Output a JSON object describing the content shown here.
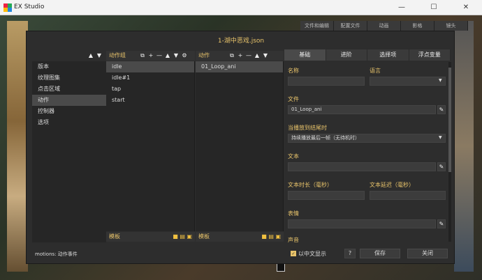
{
  "window": {
    "title": "EX Studio",
    "min": "—",
    "max": "☐",
    "close": "✕"
  },
  "bg_tabs": [
    "文件和编辑",
    "配置文件",
    "动画",
    "影格",
    "镜头"
  ],
  "dialog": {
    "title": "1-湖中恶戏.json",
    "left": {
      "up": "▲",
      "down": "▼",
      "items": [
        "版本",
        "纹理图集",
        "点击区域",
        "动作",
        "控制器",
        "选项"
      ],
      "selected": 3
    },
    "groups": {
      "header": "动作组",
      "ctl": [
        "⧉",
        "+",
        "—",
        "▲",
        "▼",
        "⚙"
      ],
      "items": [
        "idle",
        "idle#1",
        "tap",
        "start"
      ],
      "selected": 0,
      "footer": "模板",
      "footer_icons": "■ ▤ ▣"
    },
    "actions": {
      "header": "动作",
      "ctl": [
        "⧉",
        "+",
        "—",
        "▲",
        "▼"
      ],
      "items": [
        "01_Loop_ani"
      ],
      "selected": 0,
      "footer": "模板",
      "footer_icons": "■ ▤ ▣"
    },
    "tabs": [
      "基础",
      "进阶",
      "选择项",
      "浮点变量"
    ],
    "active_tab": 0,
    "form": {
      "name_label": "名称",
      "name_value": "",
      "lang_label": "语言",
      "lang_value": "",
      "file_label": "文件",
      "file_value": "01_Loop_ani",
      "end_label": "当播放到结尾时",
      "end_value": "持续播放最后一帧（无待机时）",
      "text_label": "文本",
      "text_value": "",
      "dur_label": "文本时长（毫秒）",
      "dur_value": "",
      "delay_label": "文本延迟（毫秒）",
      "delay_value": "",
      "expr_label": "表情",
      "expr_value": "",
      "sound_label": "声音"
    },
    "status": "motions: 动作事件",
    "chk_label": "以中文显示",
    "help": "?",
    "save": "保存",
    "close": "关闭"
  }
}
